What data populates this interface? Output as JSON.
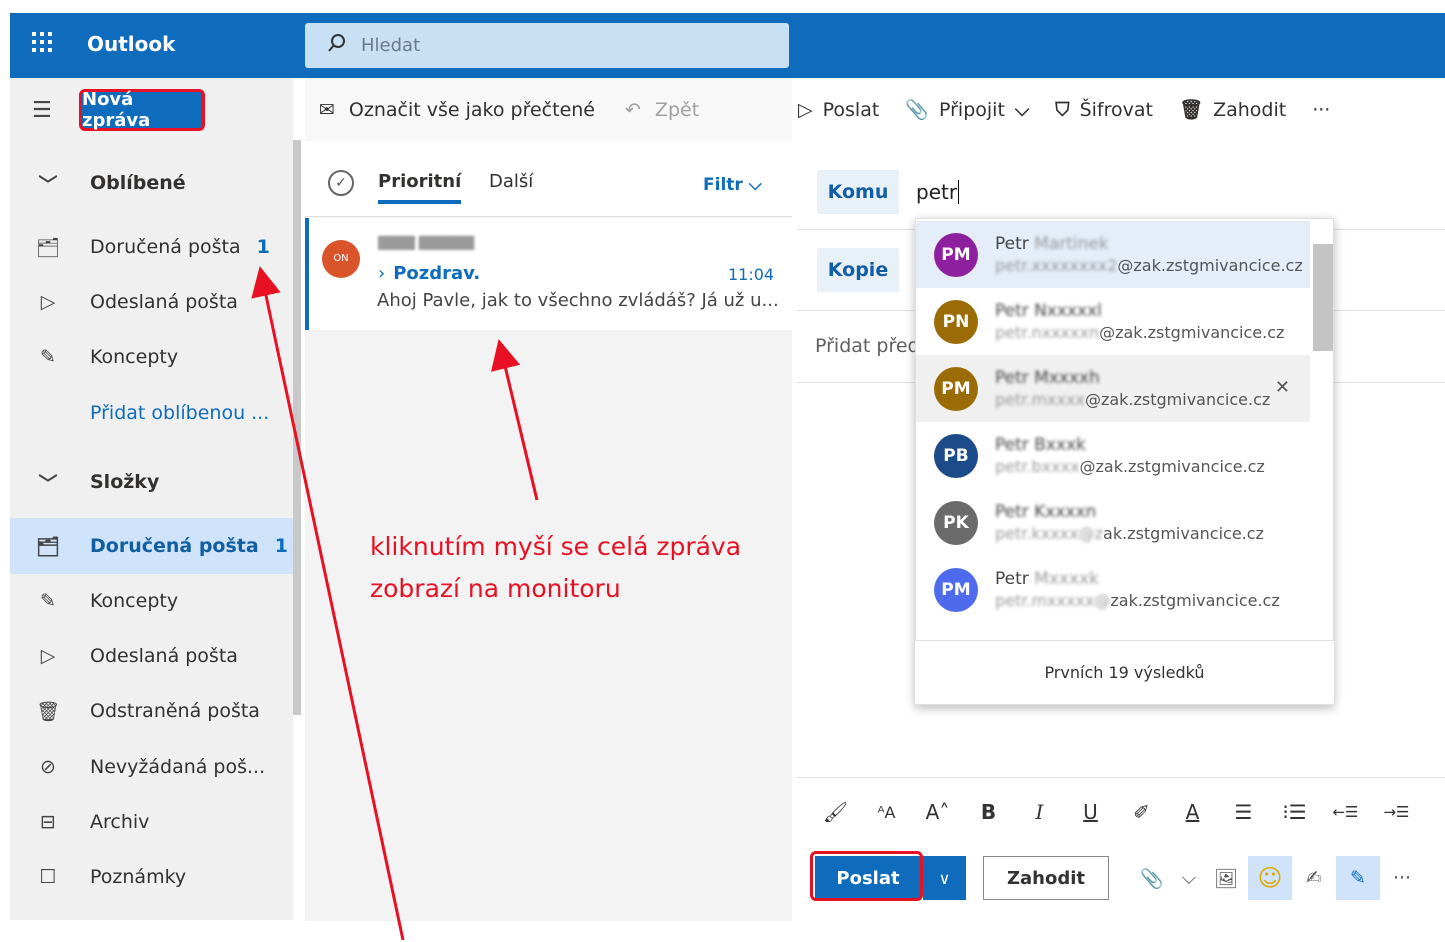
{
  "app": {
    "title": "Outlook"
  },
  "search": {
    "placeholder": "Hledat"
  },
  "nav": {
    "new_message": "Nová zpráva",
    "favorites_header": "Oblíbené",
    "favorites": [
      {
        "label": "Doručená pošta",
        "count": "1",
        "icon": "inbox-icon"
      },
      {
        "label": "Odeslaná pošta",
        "icon": "send-icon"
      },
      {
        "label": "Koncepty",
        "icon": "pencil-icon"
      }
    ],
    "add_favorite": "Přidat oblíbenou ...",
    "folders_header": "Složky",
    "folders": [
      {
        "label": "Doručená pošta",
        "count": "1",
        "icon": "inbox-icon",
        "selected": true
      },
      {
        "label": "Koncepty",
        "icon": "pencil-icon"
      },
      {
        "label": "Odeslaná pošta",
        "icon": "send-icon"
      },
      {
        "label": "Odstraněná pošta",
        "icon": "trash-icon"
      },
      {
        "label": "Nevyžádaná poš...",
        "icon": "block-icon"
      },
      {
        "label": "Archiv",
        "icon": "archive-icon"
      },
      {
        "label": "Poznámky",
        "icon": "note-icon"
      }
    ]
  },
  "list_toolbar": {
    "mark_all_read": "Označit vše jako přečtené",
    "undo": "Zpět"
  },
  "list": {
    "tab_focused": "Prioritní",
    "tab_other": "Další",
    "filter": "Filtr",
    "message": {
      "subject": "Pozdrav.",
      "time": "11:04",
      "preview": "Ahoj Pavle, jak to všechno zvládáš? Já už u..."
    }
  },
  "compose_toolbar": {
    "send": "Poslat",
    "attach": "Připojit",
    "encrypt": "Šifrovat",
    "discard": "Zahodit",
    "more": "···"
  },
  "compose": {
    "to_label": "Komu",
    "to_value": "petr",
    "cc_label": "Kopie",
    "subject_placeholder": "Přidat předr",
    "suggestions": [
      {
        "initials": "PM",
        "name": "Petr",
        "email": "@zak.zstgmivancice.cz",
        "color": "#8e1f9e"
      },
      {
        "initials": "PN",
        "name": "",
        "email": "@zak.zstgmivancice.cz",
        "color": "#9b6b05"
      },
      {
        "initials": "PM",
        "name": "",
        "email": "@zak.zstgmivancice.cz",
        "color": "#9b6b05"
      },
      {
        "initials": "PB",
        "name": "",
        "email": "@zak.zstgmivancice.cz",
        "color": "#1c4b8a"
      },
      {
        "initials": "PK",
        "name": "",
        "email": "ak.zstgmivancice.cz",
        "color": "#6b6b6b"
      },
      {
        "initials": "PM",
        "name": "Petr",
        "email": "zak.zstgmivancice.cz",
        "color": "#4f6bed"
      }
    ],
    "results_footer": "Prvních 19 výsledků",
    "send_button": "Poslat",
    "discard_button": "Zahodit"
  },
  "annotation": {
    "line1": "kliknutím myší se celá zpráva",
    "line2": "zobrazí na monitoru"
  }
}
